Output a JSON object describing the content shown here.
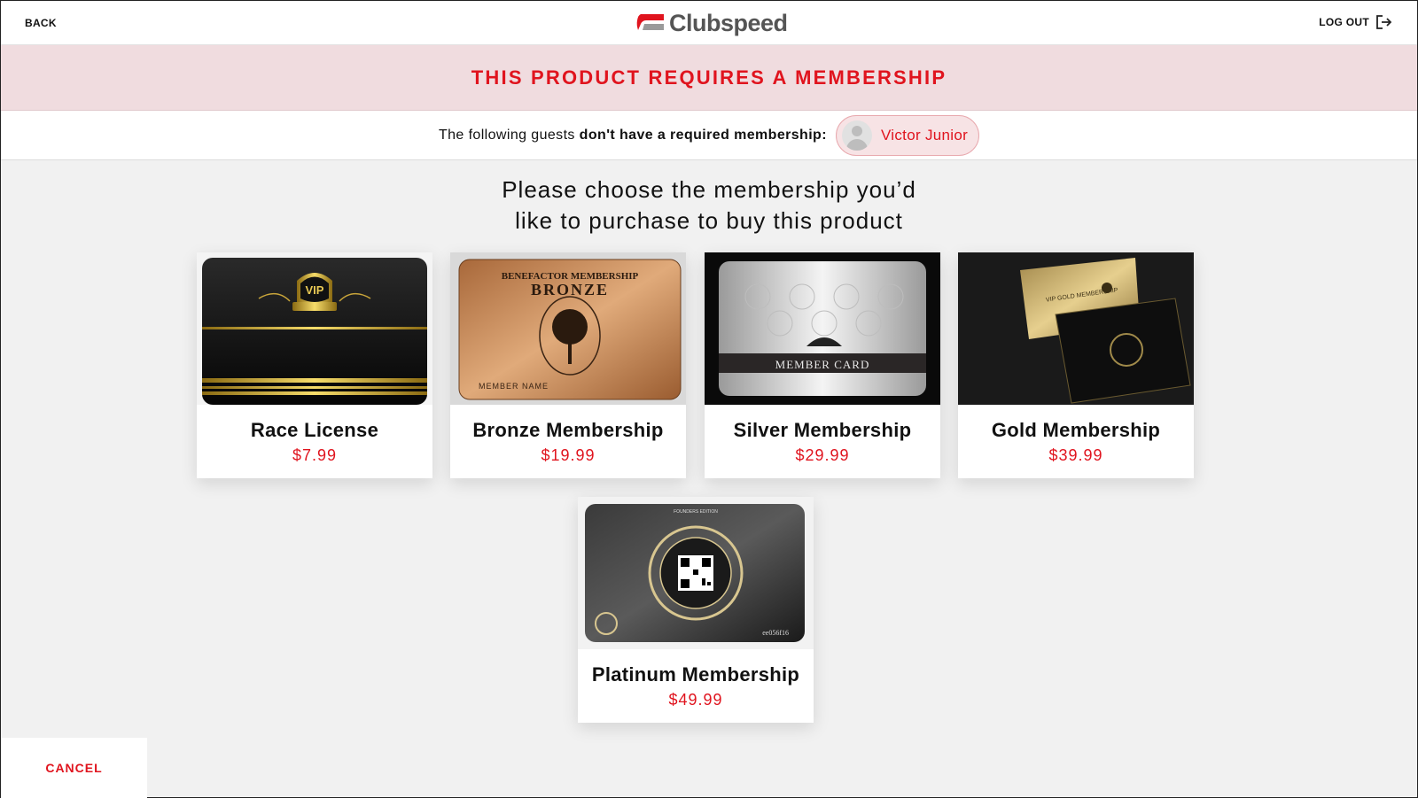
{
  "header": {
    "back_label": "BACK",
    "brand_name": "Clubspeed",
    "logout_label": "LOG OUT"
  },
  "banner": {
    "title": "THIS PRODUCT REQUIRES A MEMBERSHIP"
  },
  "guests": {
    "prefix": "The following guests ",
    "emphasis": "don't have a required membership",
    "suffix": ":",
    "items": [
      {
        "name": "Victor Junior",
        "icon": "user-avatar-icon"
      }
    ]
  },
  "prompt": {
    "line1": "Please choose the membership you’d",
    "line2": "like to purchase to buy this product"
  },
  "memberships": [
    {
      "name": "Race License",
      "price": "$7.99",
      "image_text": "VIP"
    },
    {
      "name": "Bronze Membership",
      "price": "$19.99",
      "image_text_top": "BENEFACTOR MEMBERSHIP",
      "image_text_main": "BRONZE",
      "image_text_bottom": "MEMBER NAME"
    },
    {
      "name": "Silver Membership",
      "price": "$29.99",
      "image_text": "MEMBER CARD"
    },
    {
      "name": "Gold Membership",
      "price": "$39.99",
      "image_text": "VIP GOLD MEMBERSHIP"
    },
    {
      "name": "Platinum Membership",
      "price": "$49.99",
      "image_text_top": "FOUNDERS EDITION",
      "image_text_code": "ee056f16"
    }
  ],
  "footer": {
    "cancel_label": "CANCEL"
  },
  "colors": {
    "accent": "#e0141e",
    "banner_bg": "#f0dcdf",
    "page_bg": "#f1f1f1"
  }
}
